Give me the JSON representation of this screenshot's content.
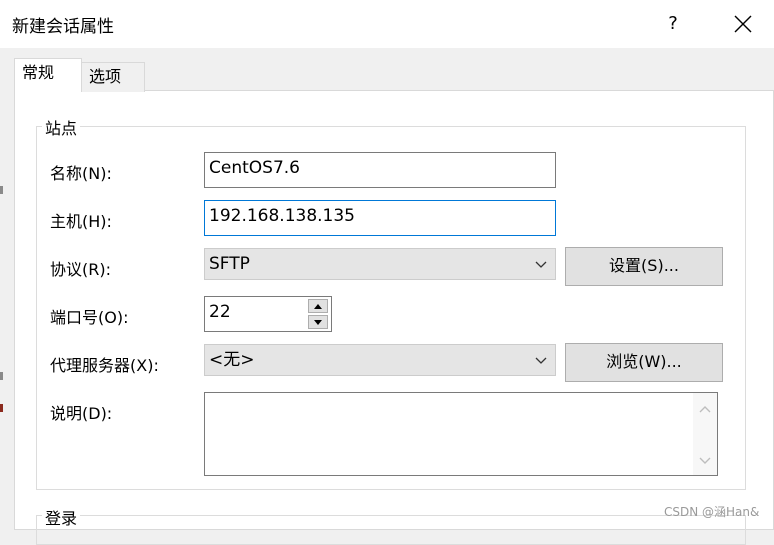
{
  "window": {
    "title": "新建会话属性",
    "help_label": "?"
  },
  "tabs": [
    {
      "label": "常规",
      "selected": true
    },
    {
      "label": "选项",
      "selected": false
    }
  ],
  "site_group": {
    "title": "站点",
    "name_label": "名称(N):",
    "name_value": "CentOS7.6",
    "host_label": "主机(H):",
    "host_value": "192.168.138.135",
    "protocol_label": "协议(R):",
    "protocol_value": "SFTP",
    "settings_button": "设置(S)...",
    "port_label": "端口号(O):",
    "port_value": "22",
    "proxy_label": "代理服务器(X):",
    "proxy_value": "<无>",
    "browse_button": "浏览(W)...",
    "description_label": "说明(D):",
    "description_value": ""
  },
  "login_group": {
    "title": "登录"
  },
  "watermark": "CSDN @涵Han&",
  "colors": {
    "focus_border": "#0078d7",
    "panel_bg": "#ffffff",
    "window_bg": "#f0f0f0"
  }
}
